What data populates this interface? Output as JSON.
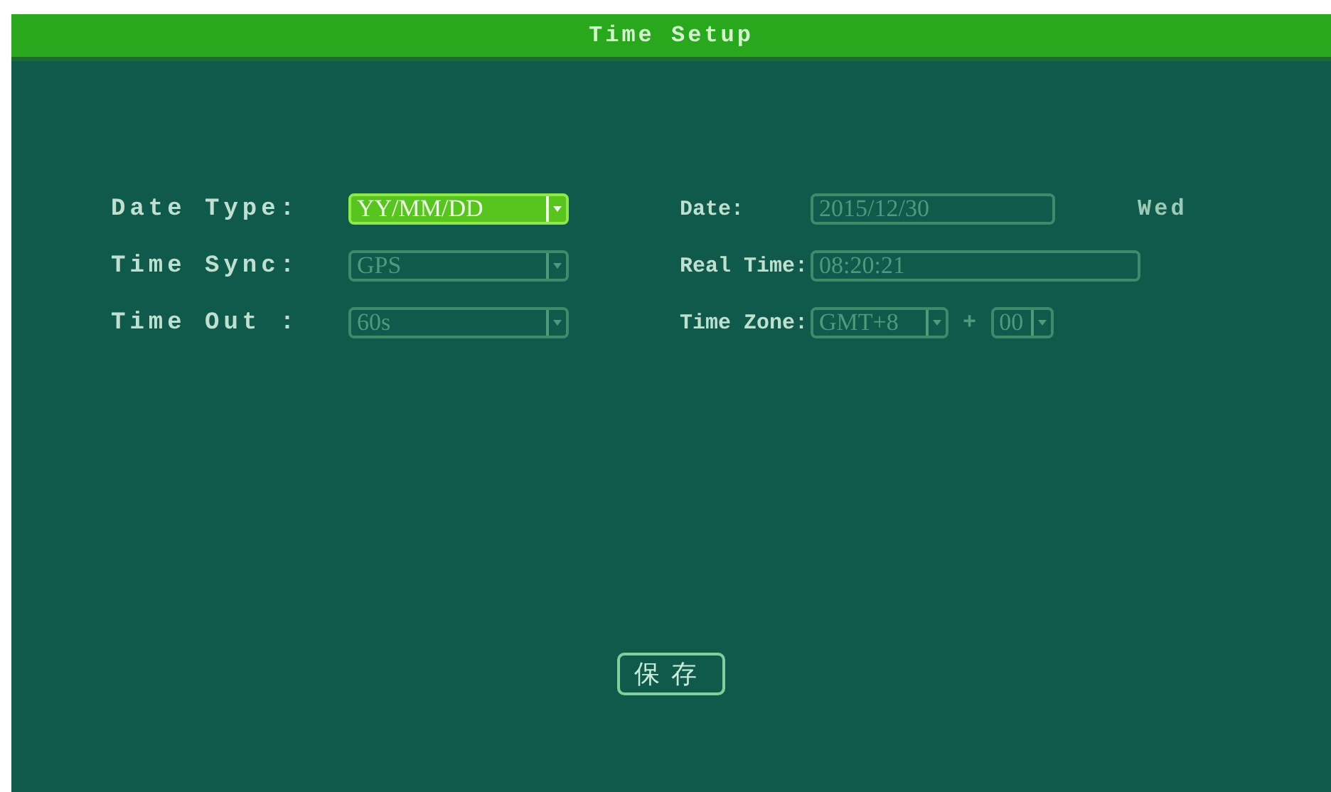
{
  "window": {
    "title": "Time Setup"
  },
  "left_fields": [
    {
      "label": "Date Type:",
      "kind": "dropdown",
      "value": "YY/MM/DD",
      "selected": true
    },
    {
      "label": "Time Sync:",
      "kind": "dropdown",
      "value": "GPS",
      "selected": false
    },
    {
      "label": "Time Out :",
      "kind": "dropdown",
      "value": "60s",
      "selected": false
    }
  ],
  "right_fields": [
    {
      "label": "Date:",
      "kind": "text",
      "value": "2015/12/30",
      "selected": false,
      "suffix": "Wed"
    },
    {
      "label": "Real Time:",
      "kind": "text",
      "value": "08:20:21",
      "selected": false
    },
    {
      "label": "Time Zone:",
      "kind": "dropdown",
      "value": "GMT+8",
      "selected": false,
      "separator": "+",
      "extra": {
        "kind": "dropdown",
        "value": "00",
        "selected": false
      }
    }
  ],
  "save_button": {
    "label": "保存"
  }
}
